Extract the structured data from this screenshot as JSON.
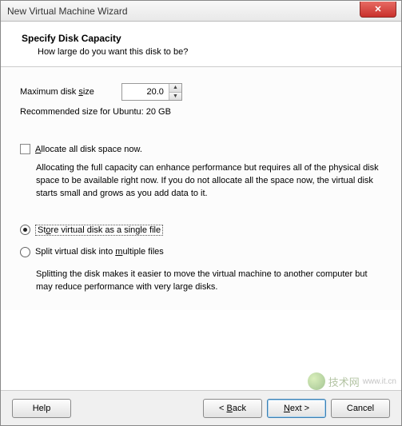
{
  "window": {
    "title": "New Virtual Machine Wizard"
  },
  "header": {
    "title": "Specify Disk Capacity",
    "subtitle": "How large do you want this disk to be?"
  },
  "size": {
    "label_pre": "Maximum disk ",
    "label_hot": "s",
    "label_post": "ize",
    "value": "20.0",
    "recommend": "Recommended size for Ubuntu: 20 GB"
  },
  "allocate": {
    "label_hot": "A",
    "label_post": "llocate all disk space now.",
    "desc": "Allocating the full capacity can enhance performance but requires all of the physical disk space to be available right now. If you do not allocate all the space now, the virtual disk starts small and grows as you add data to it."
  },
  "store_opt": {
    "label_pre": "St",
    "label_hot": "o",
    "label_post": "re virtual disk as a single file"
  },
  "split_opt": {
    "label_pre": "Split virtual disk into ",
    "label_hot": "m",
    "label_post": "ultiple files",
    "desc": "Splitting the disk makes it easier to move the virtual machine to another computer but may reduce performance with very large disks."
  },
  "buttons": {
    "help": "Help",
    "back": "< Back",
    "next": "Next >",
    "cancel": "Cancel"
  },
  "watermark": {
    "text": "技术网",
    "url": "www.it.cn"
  }
}
